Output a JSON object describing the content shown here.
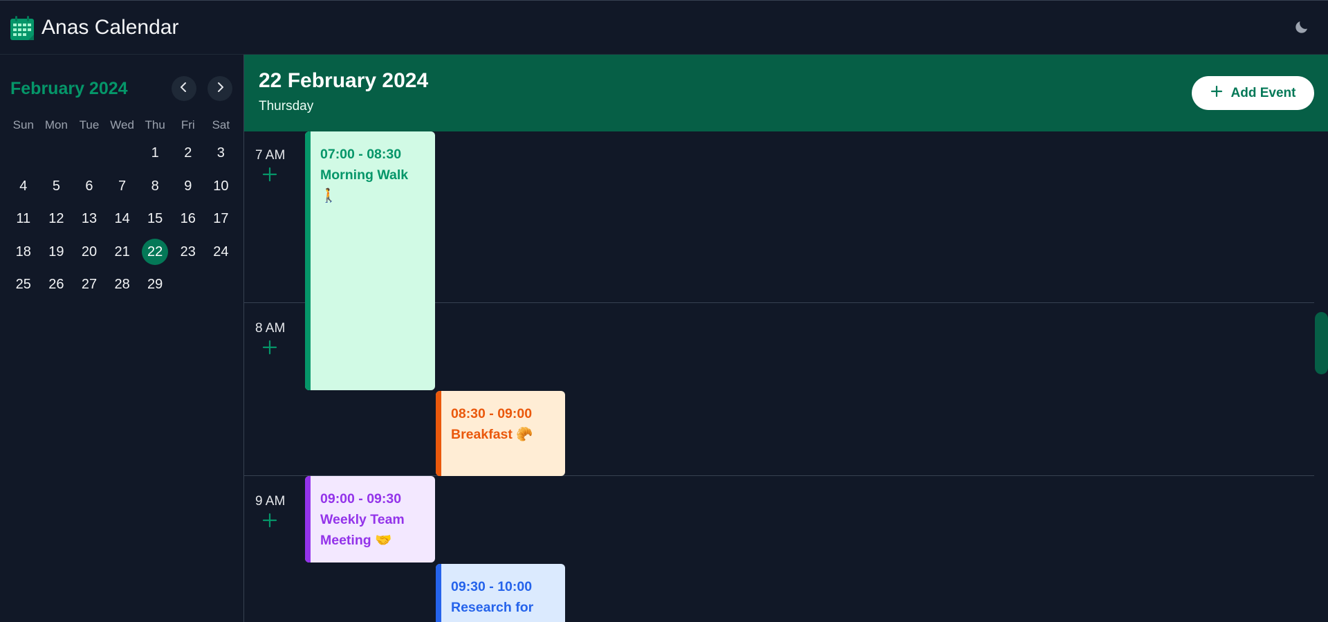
{
  "app": {
    "title": "Anas Calendar",
    "logo_icon": "calendar-icon",
    "theme_icon": "moon-icon",
    "accent": "#059669",
    "header_bg": "#065f46"
  },
  "sidebar": {
    "month_title": "February 2024",
    "prev_icon": "chevron-left-icon",
    "next_icon": "chevron-right-icon",
    "weekdays": [
      "Sun",
      "Mon",
      "Tue",
      "Wed",
      "Thu",
      "Fri",
      "Sat"
    ],
    "leading_blanks": 4,
    "days": [
      "1",
      "2",
      "3",
      "4",
      "5",
      "6",
      "7",
      "8",
      "9",
      "10",
      "11",
      "12",
      "13",
      "14",
      "15",
      "16",
      "17",
      "18",
      "19",
      "20",
      "21",
      "22",
      "23",
      "24",
      "25",
      "26",
      "27",
      "28",
      "29"
    ],
    "selected_day": "22"
  },
  "main": {
    "date_title": "22 February 2024",
    "weekday": "Thursday",
    "add_event_label": "Add Event",
    "add_event_icon": "plus-icon",
    "hours": [
      {
        "label": "7 AM"
      },
      {
        "label": "8 AM"
      },
      {
        "label": "9 AM"
      }
    ],
    "events": [
      {
        "time": "07:00 - 08:30",
        "title": "Morning Walk",
        "emoji": "🚶",
        "color": "green"
      },
      {
        "time": "08:30 - 09:00",
        "title": "Breakfast",
        "emoji": "🥐",
        "color": "orange"
      },
      {
        "time": "09:00 - 09:30",
        "title": "Weekly Team Meeting",
        "emoji": "🤝",
        "color": "purple"
      },
      {
        "time": "09:30 - 10:00",
        "title": "Research for",
        "emoji": "",
        "color": "blue"
      }
    ]
  }
}
